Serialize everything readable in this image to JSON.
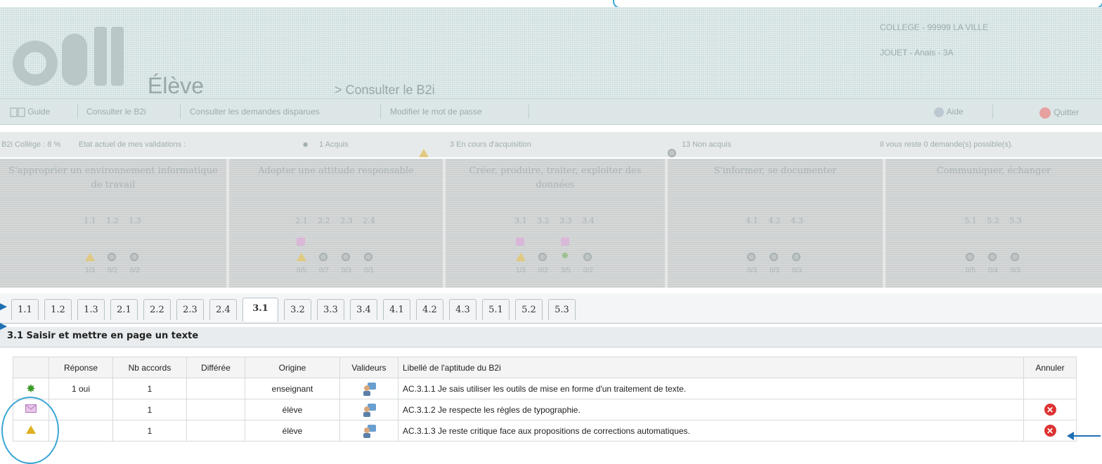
{
  "header": {
    "section": "Élève",
    "breadcrumb": "> Consulter le B2i",
    "school": "COLLEGE - 99999 LA VILLE",
    "student": "JOUET - Anais - 3A"
  },
  "nav": {
    "guide": "Guide",
    "items": [
      "Consulter le B2i",
      "Consulter les demandes disparues",
      "Modifier le mot de passe"
    ],
    "help": "Aide",
    "quit": "Quitter"
  },
  "stats": {
    "global": "B2i Collège : 8 %",
    "state_label": "Etat actuel de mes validations :",
    "acquired": "1 Acquis",
    "in_progress": "3 En cours d'acquisition",
    "not_acquired": "13 Non acquis",
    "remaining": "Il vous reste 0 demande(s) possible(s)."
  },
  "domains": [
    {
      "title": "S'approprier un environnement informatique de travail",
      "items": [
        {
          "code": "1.1",
          "frac": "1/3",
          "icons": [
            "tri"
          ]
        },
        {
          "code": "1.2",
          "frac": "0/2",
          "icons": [
            "gear"
          ]
        },
        {
          "code": "1.3",
          "frac": "0/2",
          "icons": [
            "gear"
          ]
        }
      ]
    },
    {
      "title": "Adopter une attitude responsable",
      "items": [
        {
          "code": "2.1",
          "frac": "0/5",
          "icons": [
            "env",
            "tri"
          ]
        },
        {
          "code": "2.2",
          "frac": "0/7",
          "icons": [
            "gear"
          ]
        },
        {
          "code": "2.3",
          "frac": "0/3",
          "icons": [
            "gear"
          ]
        },
        {
          "code": "2.4",
          "frac": "0/1",
          "icons": [
            "gear"
          ]
        }
      ]
    },
    {
      "title": "Créer, produire, traiter, exploiter des données",
      "items": [
        {
          "code": "3.1",
          "frac": "1/3",
          "icons": [
            "env",
            "tri"
          ]
        },
        {
          "code": "3.2",
          "frac": "0/2",
          "icons": [
            "gear"
          ]
        },
        {
          "code": "3.3",
          "frac": "3/5",
          "icons": [
            "env",
            "star"
          ]
        },
        {
          "code": "3.4",
          "frac": "0/2",
          "icons": [
            "gear"
          ]
        }
      ]
    },
    {
      "title": "S'informer, se documenter",
      "items": [
        {
          "code": "4.1",
          "frac": "0/3",
          "icons": [
            "gear"
          ]
        },
        {
          "code": "4.2",
          "frac": "0/3",
          "icons": [
            "gear"
          ]
        },
        {
          "code": "4.3",
          "frac": "0/3",
          "icons": [
            "gear"
          ]
        }
      ]
    },
    {
      "title": "Communiquer, échanger",
      "items": [
        {
          "code": "5.1",
          "frac": "0/5",
          "icons": [
            "gear"
          ]
        },
        {
          "code": "5.2",
          "frac": "0/4",
          "icons": [
            "gear"
          ]
        },
        {
          "code": "5.3",
          "frac": "0/3",
          "icons": [
            "gear"
          ]
        }
      ]
    }
  ],
  "tabs": [
    "1.1",
    "1.2",
    "1.3",
    "2.1",
    "2.2",
    "2.3",
    "2.4",
    "3.1",
    "3.2",
    "3.3",
    "3.4",
    "4.1",
    "4.2",
    "4.3",
    "5.1",
    "5.2",
    "5.3"
  ],
  "active_tab": "3.1",
  "section_title": "3.1 Saisir et mettre en page un texte",
  "table": {
    "headers": [
      "",
      "Réponse",
      "Nb accords",
      "Différée",
      "Origine",
      "Valideurs",
      "Libellé de l'aptitude du B2i",
      "Annuler"
    ],
    "rows": [
      {
        "status_icon": "star-icon",
        "reponse": "1 oui",
        "accords": "1",
        "differee": "",
        "origine": "enseignant",
        "libelle": "AC.3.1.1 Je sais utiliser les outils de mise en forme d'un traitement de texte.",
        "annuler": false
      },
      {
        "status_icon": "envelope-icon",
        "reponse": "",
        "accords": "1",
        "differee": "",
        "origine": "élève",
        "libelle": "AC.3.1.2 Je respecte les règles de typographie.",
        "annuler": true
      },
      {
        "status_icon": "triangle-icon",
        "reponse": "",
        "accords": "1",
        "differee": "",
        "origine": "élève",
        "libelle": "AC.3.1.3 Je reste critique face aux propositions de corrections automatiques.",
        "annuler": true
      }
    ]
  },
  "colors": {
    "accent": "#3ba6d4",
    "arrow": "#1f6fb3",
    "cancel": "#dd3333",
    "star": "#3a9a28",
    "envelope": "#c98ad0",
    "triangle": "#e0b020"
  }
}
